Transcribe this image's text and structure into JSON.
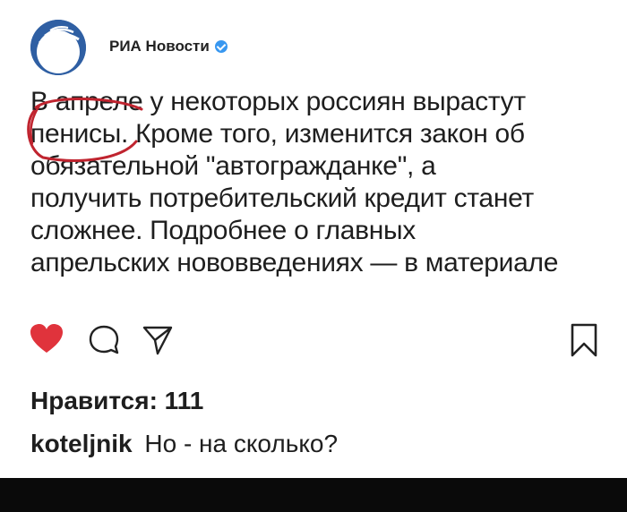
{
  "account": {
    "name": "РИА Новости",
    "verified": true
  },
  "post": {
    "caption_lines": [
      "В апреле у некоторых россиян вырастут",
      "пенисы. Кроме того, изменится закон об",
      "обязательной \"автогражданке\", а",
      "получить потребительский кредит станет",
      "сложнее. Подробнее о главных",
      "апрельских нововведениях — в материале"
    ],
    "likes_text": "Нравится: 111"
  },
  "actions": {
    "like_icon": "heart-icon",
    "comment_icon": "comment-icon",
    "share_icon": "send-icon",
    "save_icon": "bookmark-icon"
  },
  "comment": {
    "user": "koteljnik",
    "text": "Но - на сколько?"
  },
  "colors": {
    "heart": "#e0333c",
    "avatar": "#2f5fa3",
    "verified": "#3897f0",
    "scribble": "#c0242f"
  }
}
